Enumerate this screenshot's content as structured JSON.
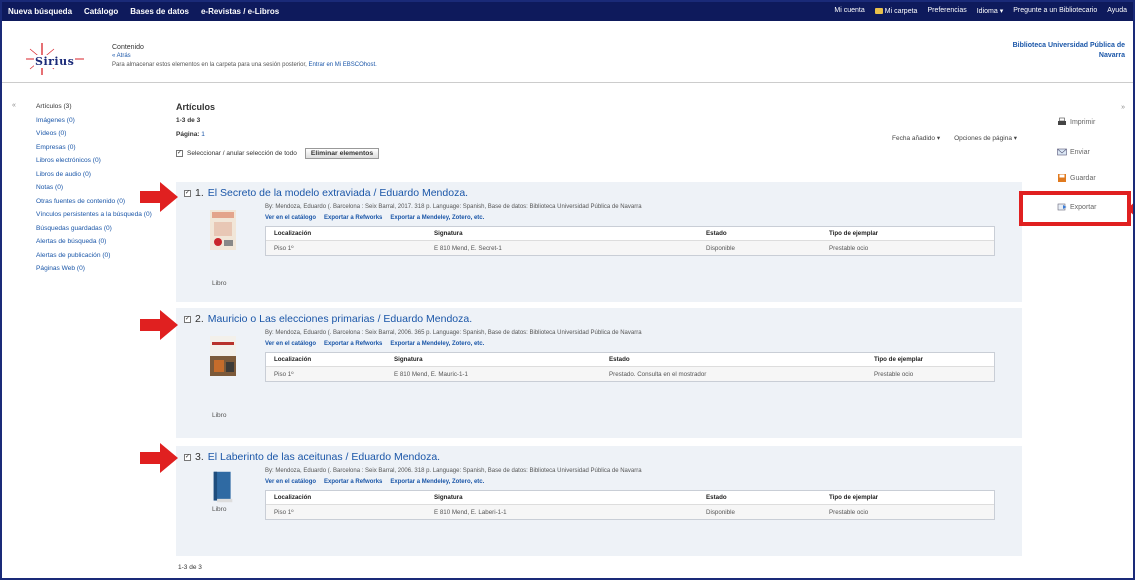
{
  "topbar": {
    "nav": [
      "Nueva búsqueda",
      "Catálogo",
      "Bases de datos",
      "e-Revistas / e-Libros"
    ],
    "right": [
      "Mi cuenta",
      "Mi carpeta",
      "Preferencias",
      "Idioma ▾",
      "Pregunte a un Bibliotecario",
      "Ayuda"
    ]
  },
  "header": {
    "logo_text": "Sirius",
    "contenido": "Contenido",
    "atras": "« Atrás",
    "note": "Para almacenar estos elementos en la carpeta para una sesión posterior,",
    "note_link": "Entrar en Mi EBSCOhost.",
    "library": "Biblioteca Universidad Pública de Navarra"
  },
  "sidebar": {
    "items": [
      "Artículos (3)",
      "Imágenes (0)",
      "Vídeos (0)",
      "Empresas (0)",
      "Libros electrónicos (0)",
      "Libros de audio (0)",
      "Notas (0)",
      "Otras fuentes de contenido (0)",
      "Vínculos persistentes a la búsqueda (0)",
      "Búsquedas guardadas (0)",
      "Alertas de búsqueda (0)",
      "Alertas de publicación (0)",
      "Páginas Web (0)"
    ]
  },
  "main": {
    "heading": "Artículos",
    "count": "1-3 de 3",
    "pagina_label": "Página:",
    "pagina_num": "1",
    "sort": "Fecha añadido ▾",
    "options": "Opciones de página ▾",
    "select_all": "Seleccionar / anular selección de todo",
    "delete_btn": "Eliminar elementos",
    "footer_count": "1-3 de 3"
  },
  "table_headers": {
    "loc": "Localización",
    "sig": "Signatura",
    "estado": "Estado",
    "tipo": "Tipo de ejemplar"
  },
  "results": [
    {
      "num": "1.",
      "title": "El Secreto de la modelo extraviada / Eduardo Mendoza.",
      "byline": "By: Mendoza, Eduardo (. Barcelona : Seix Barral, 2017. 318 p. Language: Spanish, Base de datos: Biblioteca Universidad Pública de Navarra",
      "link1": "Ver en el catálogo",
      "link2": "Exportar a Refworks",
      "link3": "Exportar a Mendeley, Zotero, etc.",
      "type": "Libro",
      "loc": "Piso 1º",
      "sig": "E 810 Mend, E. Secret-1",
      "estado": "Disponible",
      "tipo": "Prestable ocio"
    },
    {
      "num": "2.",
      "title": "Mauricio o Las elecciones primarias / Eduardo Mendoza.",
      "byline": "By: Mendoza, Eduardo (. Barcelona : Seix Barral, 2006. 365 p. Language: Spanish, Base de datos: Biblioteca Universidad Pública de Navarra",
      "link1": "Ver en el catálogo",
      "link2": "Exportar a Refworks",
      "link3": "Exportar a Mendeley, Zotero, etc.",
      "type": "Libro",
      "loc": "Piso 1º",
      "sig": "E 810 Mend, E. Mauric-1-1",
      "estado": "Prestado. Consulta en el mostrador",
      "tipo": "Prestable ocio"
    },
    {
      "num": "3.",
      "title": "El Laberinto de las aceitunas / Eduardo Mendoza.",
      "byline": "By: Mendoza, Eduardo (. Barcelona : Seix Barral, 2006. 318 p. Language: Spanish, Base de datos: Biblioteca Universidad Pública de Navarra",
      "link1": "Ver en el catálogo",
      "link2": "Exportar a Refworks",
      "link3": "Exportar a Mendeley, Zotero, etc.",
      "type": "Libro",
      "loc": "Piso 1º",
      "sig": "E 810 Mend, E. Laberi-1-1",
      "estado": "Disponible",
      "tipo": "Prestable ocio"
    }
  ],
  "right_actions": [
    "Imprimir",
    "Enviar",
    "Guardar",
    "Exportar"
  ],
  "colors": {
    "topbar": "#0e1a5c",
    "link": "#1a56a8",
    "highlight": "#e02020",
    "result_bg": "#eef2f7"
  },
  "icons": {
    "printer": "printer-icon",
    "email": "email-icon",
    "save": "save-icon",
    "export": "export-icon"
  }
}
